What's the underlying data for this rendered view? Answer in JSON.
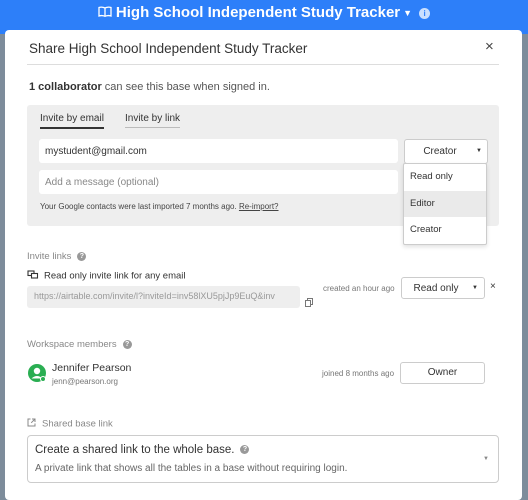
{
  "app": {
    "title": "High School Independent Study Tracker"
  },
  "modal": {
    "title": "Share High School Independent Study Tracker",
    "close_glyph": "×",
    "collaborators_count": "1 collaborator",
    "collaborators_text": " can see this base when signed in."
  },
  "invite": {
    "tabs": [
      "Invite by email",
      "Invite by link"
    ],
    "email_value": "mystudent@gmail.com",
    "message_placeholder": "Add a message (optional)",
    "contacts_note": "Your Google contacts were last imported 7 months ago.",
    "reimport_label": "Re-import?",
    "role_selected": "Creator",
    "role_options": [
      "Read only",
      "Editor",
      "Creator"
    ],
    "highlighted_option": "Editor"
  },
  "invite_links": {
    "heading": "Invite links",
    "help_glyph": "?",
    "readonly_label": "Read only invite link for any email",
    "url": "https://airtable.com/invite/l?inviteId=inv58lXU5pjJp9EuQ&inv",
    "created": "created an hour ago",
    "permission": "Read only",
    "remove_glyph": "×"
  },
  "workspace": {
    "heading": "Workspace members",
    "member_name": "Jennifer Pearson",
    "member_email": "jenn@pearson.org",
    "joined": "joined 8 months ago",
    "role": "Owner"
  },
  "shared_base": {
    "heading": "Shared base link",
    "title": "Create a shared link to the whole base.",
    "subtitle": "A private link that shows all the tables in a base without requiring login."
  },
  "colors": {
    "header_blue": "#2d7ff9",
    "avatar_green": "#2aae52",
    "panel_gray": "#eeeeee"
  }
}
